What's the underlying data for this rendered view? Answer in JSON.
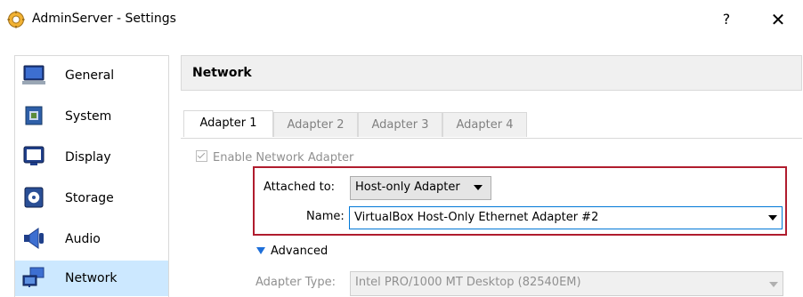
{
  "window": {
    "title": "AdminServer - Settings",
    "help_label": "?",
    "close_label": "✕"
  },
  "sidebar": {
    "items": [
      {
        "label": "General",
        "icon": "general-monitor-icon"
      },
      {
        "label": "System",
        "icon": "chip-icon"
      },
      {
        "label": "Display",
        "icon": "display-icon"
      },
      {
        "label": "Storage",
        "icon": "storage-icon"
      },
      {
        "label": "Audio",
        "icon": "speaker-icon"
      },
      {
        "label": "Network",
        "icon": "network-icon",
        "selected": true
      }
    ]
  },
  "main": {
    "section_title": "Network",
    "tabs": [
      {
        "label": "Adapter 1",
        "active": true
      },
      {
        "label": "Adapter 2"
      },
      {
        "label": "Adapter 3"
      },
      {
        "label": "Adapter 4"
      }
    ],
    "enable_label": "Enable Network Adapter",
    "enable_checked": true,
    "attached_to": {
      "label": "Attached to:",
      "value": "Host-only Adapter"
    },
    "name": {
      "label": "Name:",
      "value": "VirtualBox Host-Only Ethernet Adapter #2"
    },
    "advanced_label": "Advanced",
    "adapter_type": {
      "label": "Adapter Type:",
      "value": "Intel PRO/1000 MT Desktop (82540EM)"
    }
  },
  "colors": {
    "selection": "#cce8ff",
    "highlight_border": "#b01c2e",
    "focus_border": "#0078d7",
    "accent_arrow": "#1e6fd9"
  }
}
